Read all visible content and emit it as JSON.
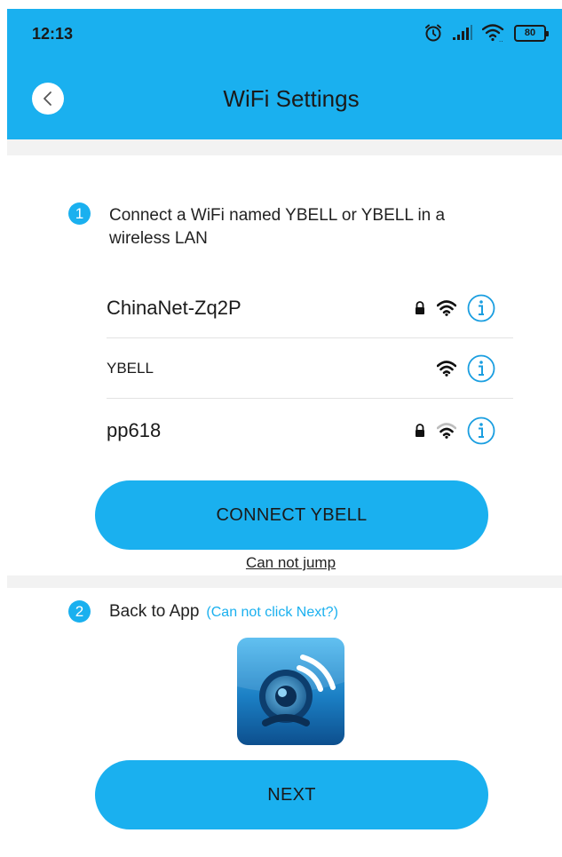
{
  "status_bar": {
    "time": "12:13",
    "battery": "80"
  },
  "header": {
    "title": "WiFi Settings",
    "colors": {
      "accent": "#1ab0ef"
    }
  },
  "step1": {
    "number": "1",
    "text": "Connect a WiFi named YBELL or YBELL in a wireless LAN"
  },
  "networks": [
    {
      "ssid": "ChinaNet-Zq2P",
      "locked": true,
      "signal": "strong"
    },
    {
      "ssid": "YBELL",
      "locked": false,
      "signal": "strong"
    },
    {
      "ssid": "pp618",
      "locked": true,
      "signal": "weak"
    }
  ],
  "connect_button": {
    "label": "CONNECT YBELL"
  },
  "cannot_jump": "Can not jump",
  "step2": {
    "number": "2",
    "text": "Back to App",
    "hint": "(Can not click Next?)"
  },
  "next_button": {
    "label": "NEXT"
  }
}
